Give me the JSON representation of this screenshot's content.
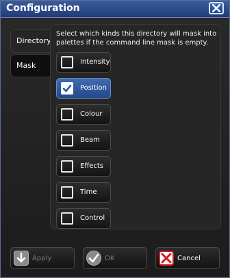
{
  "window": {
    "title": "Configuration"
  },
  "tabs": [
    {
      "label": "Directory",
      "active": true
    },
    {
      "label": "Mask",
      "active": false
    }
  ],
  "description": "Select which kinds this directory will mask into palettes if the command line mask is empty.",
  "mask_options": [
    {
      "label": "Intensity",
      "checked": false
    },
    {
      "label": "Position",
      "checked": true
    },
    {
      "label": "Colour",
      "checked": false
    },
    {
      "label": "Beam",
      "checked": false
    },
    {
      "label": "Effects",
      "checked": false
    },
    {
      "label": "Time",
      "checked": false
    },
    {
      "label": "Control",
      "checked": false
    }
  ],
  "buttons": {
    "apply": {
      "label": "Apply",
      "enabled": false,
      "icon": "down-arrow-icon"
    },
    "ok": {
      "label": "OK",
      "enabled": false,
      "icon": "check-icon"
    },
    "cancel": {
      "label": "Cancel",
      "enabled": true,
      "icon": "cancel-x-icon"
    }
  },
  "colors": {
    "titlebar": "#2a4a8c",
    "checked_blue": "#3f6bb4",
    "cancel_red": "#d21c1c"
  }
}
